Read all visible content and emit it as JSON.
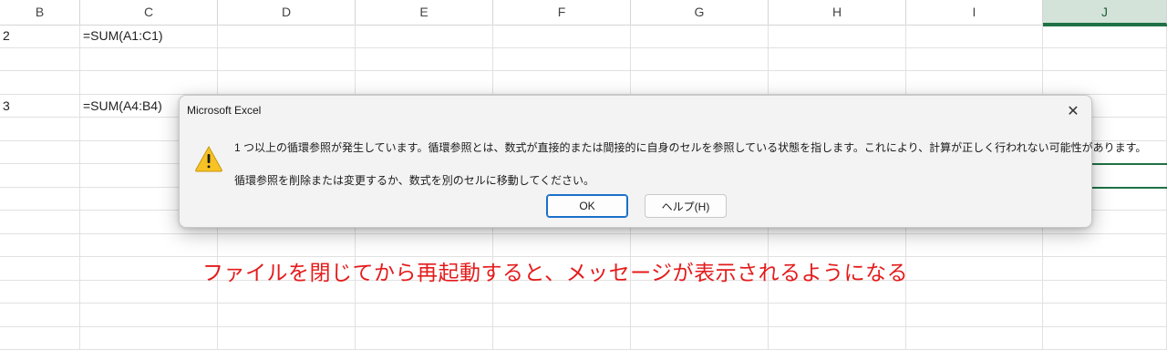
{
  "columns": [
    "B",
    "C",
    "D",
    "E",
    "F",
    "G",
    "H",
    "I",
    "J"
  ],
  "selected_column": "J",
  "cells": {
    "b1": "2",
    "c1": "=SUM(A1:C1)",
    "b4": "3",
    "c4": "=SUM(A4:B4)"
  },
  "dialog": {
    "title": "Microsoft Excel",
    "close_glyph": "✕",
    "message_line1": "1 つ以上の循環参照が発生しています。循環参照とは、数式が直接的または間接的に自身のセルを参照している状態を指します。これにより、計算が正しく行われない可能性があります。",
    "message_line2": "循環参照を削除または変更するか、数式を別のセルに移動してください。",
    "ok_label": "OK",
    "help_label": "ヘルプ(H)",
    "icon": "warning-icon"
  },
  "caption": "ファイルを閉じてから再起動すると、メッセージが表示されるようになる",
  "colors": {
    "selected_column": "#1e7145",
    "caption": "#e41b1b",
    "warning": "#f7c223"
  }
}
